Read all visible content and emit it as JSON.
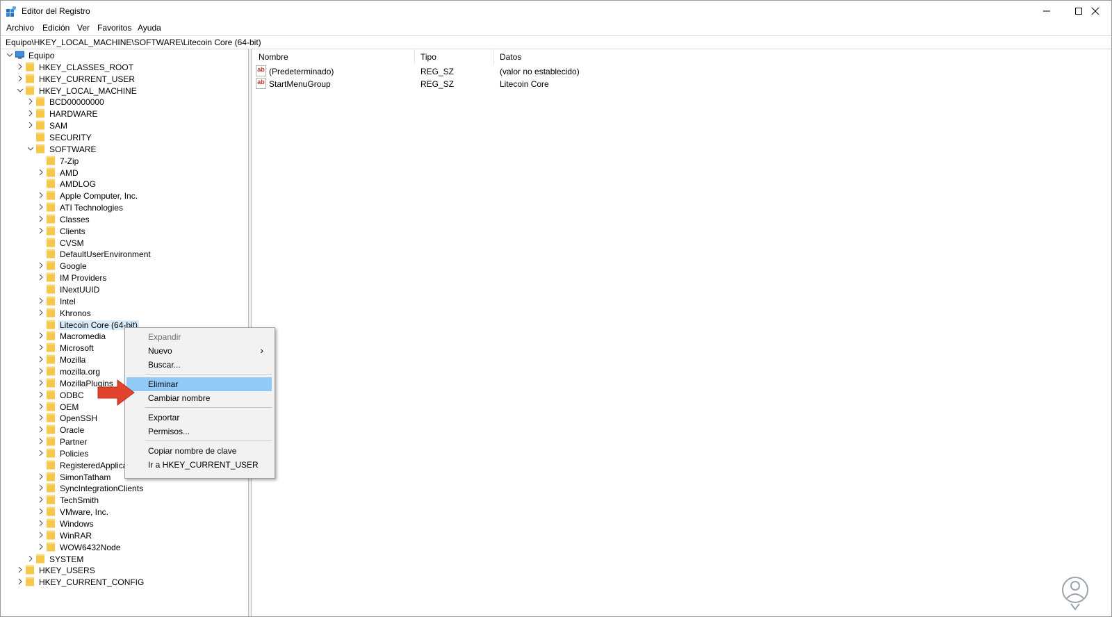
{
  "window": {
    "title": "Editor del Registro",
    "minimize": "─",
    "maximize": "☐",
    "close": "✕"
  },
  "menu": [
    "Archivo",
    "Edición",
    "Ver",
    "Favoritos",
    "Ayuda"
  ],
  "address": "Equipo\\HKEY_LOCAL_MACHINE\\SOFTWARE\\Litecoin Core (64-bit)",
  "tree": {
    "root": "Equipo",
    "hives": [
      "HKEY_CLASSES_ROOT",
      "HKEY_CURRENT_USER",
      "HKEY_LOCAL_MACHINE"
    ],
    "hklm_children": [
      "BCD00000000",
      "HARDWARE",
      "SAM",
      "SECURITY",
      "SOFTWARE"
    ],
    "software_children": [
      "7-Zip",
      "AMD",
      "AMDLOG",
      "Apple Computer, Inc.",
      "ATI Technologies",
      "Classes",
      "Clients",
      "CVSM",
      "DefaultUserEnvironment",
      "Google",
      "IM Providers",
      "INextUUID",
      "Intel",
      "Khronos",
      "Litecoin Core (64-bit)",
      "Macromedia",
      "Microsoft",
      "Mozilla",
      "mozilla.org",
      "MozillaPlugins",
      "ODBC",
      "OEM",
      "OpenSSH",
      "Oracle",
      "Partner",
      "Policies",
      "RegisteredApplications",
      "SimonTatham",
      "SyncIntegrationClients",
      "TechSmith",
      "VMware, Inc.",
      "Windows",
      "WinRAR",
      "WOW6432Node"
    ],
    "after_software": [
      "SYSTEM"
    ],
    "tail_hives": [
      "HKEY_USERS",
      "HKEY_CURRENT_CONFIG"
    ]
  },
  "list": {
    "headers": [
      "Nombre",
      "Tipo",
      "Datos"
    ],
    "rows": [
      {
        "icon": "ab",
        "name": "(Predeterminado)",
        "type": "REG_SZ",
        "data": "(valor no establecido)"
      },
      {
        "icon": "ab",
        "name": "StartMenuGroup",
        "type": "REG_SZ",
        "data": "Litecoin Core"
      }
    ]
  },
  "context_menu": {
    "items": [
      {
        "label": "Expandir",
        "disabled": true
      },
      {
        "label": "Nuevo",
        "submenu": true
      },
      {
        "label": "Buscar..."
      },
      {
        "label": "Eliminar",
        "highlighted": true
      },
      {
        "label": "Cambiar nombre"
      },
      {
        "label": "Exportar"
      },
      {
        "label": "Permisos..."
      },
      {
        "label": "Copiar nombre de clave"
      },
      {
        "label": "Ir a HKEY_CURRENT_USER"
      }
    ],
    "submenu_arrow": "›"
  },
  "colors": {
    "folder": "#f6c84a",
    "selection": "#d9ebf9",
    "menu_highlight": "#91c9f7",
    "arrow": "#e2432c"
  },
  "overlay_logo": "solvetic-logo"
}
